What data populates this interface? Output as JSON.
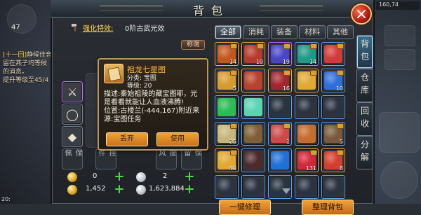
{
  "window": {
    "title": "背包"
  },
  "left_hud": {
    "level": "47",
    "chat": [
      {
        "kind": "[十一回]",
        "text": "静候佳音"
      },
      {
        "kind": "",
        "text": "留在燕子坞等候"
      },
      {
        "kind": "",
        "text": "的消息。"
      },
      {
        "kind": "",
        "text": "提升等级至45/4"
      }
    ],
    "clock": "20:"
  },
  "right_hud": {
    "coord": "160,74"
  },
  "character": {
    "effect_label": "强化特效:",
    "effect_value": "0阶古武光效",
    "title_badge": "称谓",
    "slots": [
      {
        "name": "weapon",
        "glyph": "⚔",
        "quality": "purple"
      },
      {
        "name": "ring",
        "glyph": "◯",
        "quality": "blue"
      },
      {
        "name": "armor",
        "glyph": "◆",
        "quality": "blue"
      }
    ],
    "equip_labels": [
      "保\n佩",
      "挂\n件",
      "披\n风",
      "保\n留"
    ]
  },
  "tooltip": {
    "name": "祖龙七星图",
    "kind": "分类: 宝图",
    "level": "等级: 20",
    "desc": "描述:秦始祖陵的藏宝图耶，光是看看就能让人血液沸腾!",
    "position": "位置:古楼兰(-444,167)附近来源:宝图任务",
    "buttons": {
      "left": "丢弃",
      "right": "使用"
    }
  },
  "currency": {
    "rows": [
      {
        "left": "0",
        "right": "2"
      },
      {
        "left": "1,452",
        "right": "1,623,884"
      }
    ]
  },
  "inventory": {
    "tabs": [
      "全部",
      "消耗",
      "装备",
      "材料",
      "其他"
    ],
    "active_tab": 0,
    "cells": [
      {
        "q": "q-orange",
        "color": "#c4571d",
        "qty": "14",
        "bind": true
      },
      {
        "q": "q-orange",
        "color": "#b53a2a",
        "qty": "10",
        "bind": true
      },
      {
        "q": "q-purple",
        "color": "#4a45c6",
        "qty": "19",
        "bind": true
      },
      {
        "q": "q-blue",
        "color": "#1e9b88",
        "qty": "14",
        "bind": true
      },
      {
        "q": "q-blue",
        "color": "#d33a3a",
        "qty": "",
        "bind": true
      },
      {
        "q": "q-orange",
        "color": "#d69b2f",
        "qty": "5",
        "bind": true
      },
      {
        "q": "q-orange",
        "color": "#b9422c",
        "qty": "",
        "bind": false
      },
      {
        "q": "q-orange",
        "color": "#a3262d",
        "qty": "16",
        "bind": true
      },
      {
        "q": "q-orange",
        "color": "#e1a832",
        "qty": "",
        "bind": true
      },
      {
        "q": "q-blue",
        "color": "#2f6fd9",
        "qty": "10",
        "bind": true
      },
      {
        "q": "q-blue",
        "color": "#2bbd53",
        "qty": "",
        "bind": false
      },
      {
        "q": "q-blue",
        "color": "#58d6b0",
        "qty": "",
        "bind": false
      },
      {
        "q": "q-blue",
        "color": "#2a3441",
        "qty": "",
        "bind": false
      },
      {
        "q": "q-blue",
        "color": "#2a3441",
        "qty": "",
        "bind": false
      },
      {
        "q": "q-blue",
        "color": "#2a3441",
        "qty": "",
        "bind": false
      },
      {
        "q": "q-blue",
        "color": "#c7b67a",
        "qty": "25",
        "bind": true
      },
      {
        "q": "q-blue",
        "color": "#7f5f35",
        "qty": "",
        "bind": false
      },
      {
        "q": "q-blue",
        "color": "#d24848",
        "qty": "1",
        "bind": true
      },
      {
        "q": "q-blue",
        "color": "#c56c2f",
        "qty": "",
        "bind": false
      },
      {
        "q": "q-blue",
        "color": "#7a5a3a",
        "qty": "5",
        "bind": true
      },
      {
        "q": "q-orange",
        "color": "#e2a82f",
        "qty": "40",
        "bind": true
      },
      {
        "q": "q-blue",
        "color": "#4c2b2a",
        "qty": "",
        "bind": false
      },
      {
        "q": "q-blue",
        "color": "#1f70d8",
        "qty": "",
        "bind": false
      },
      {
        "q": "q-orange",
        "color": "#d3263a",
        "qty": "131",
        "bind": true
      },
      {
        "q": "q-orange",
        "color": "#d33e2e",
        "qty": "8",
        "bind": true
      },
      {
        "q": "q-blue",
        "color": "#2a3441",
        "qty": "",
        "bind": false
      },
      {
        "q": "q-blue",
        "color": "#2a3441",
        "qty": "",
        "bind": false
      },
      {
        "q": "q-blue",
        "color": "#2a3441",
        "qty": "",
        "bind": false
      },
      {
        "q": "q-blue",
        "color": "#2a3441",
        "qty": "",
        "bind": false
      },
      {
        "q": "q-blue",
        "color": "#2a3441",
        "qty": "",
        "bind": false
      }
    ],
    "actions": {
      "repair": "一键修理",
      "sort": "整理背包"
    }
  },
  "side_tabs": [
    "背包",
    "仓库",
    "回收",
    "分解"
  ],
  "colors": {
    "accent_gold": "#f0a437",
    "frame": "#b9985d",
    "panel": "#1f2328"
  }
}
